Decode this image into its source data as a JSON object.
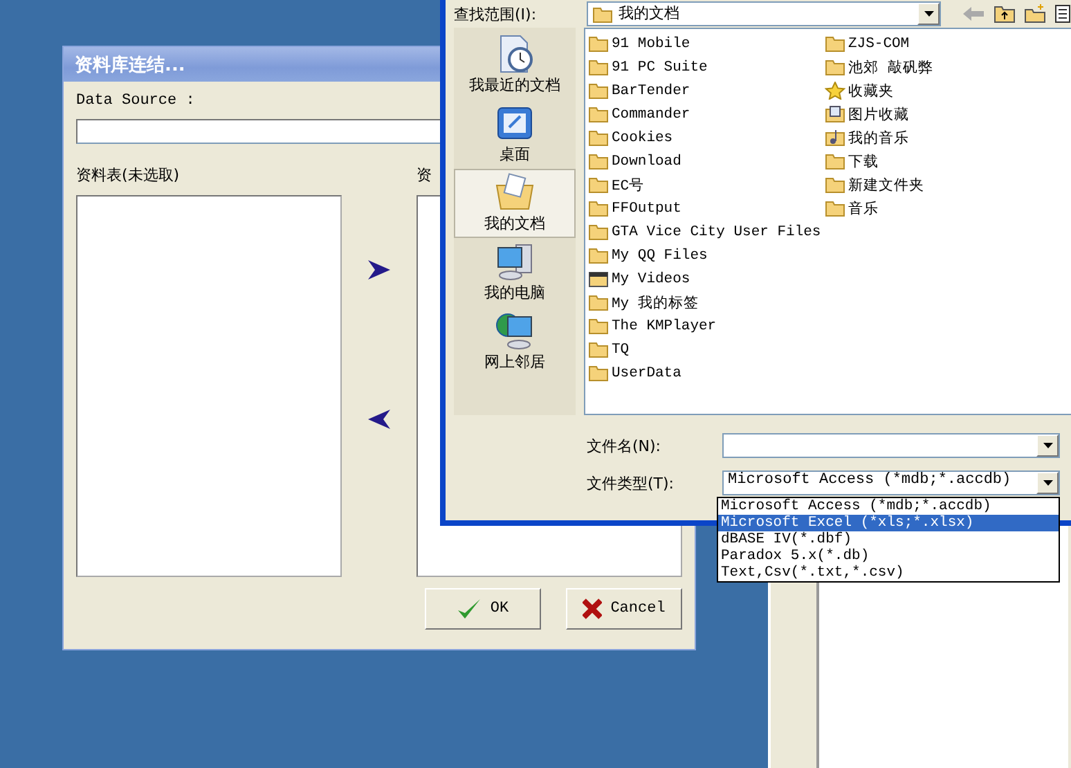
{
  "data_dialog": {
    "title": "资料库连结...",
    "data_source_label": "Data Source :",
    "tables_label": "资料表(未选取)",
    "second_label": "资",
    "buttons": [
      {
        "label": "OK",
        "kind": "ok"
      },
      {
        "label": "Cancel",
        "kind": "cancel"
      }
    ]
  },
  "file_dialog": {
    "look_in_label": "查找范围(I):",
    "look_in_value": "我的文档",
    "places": [
      {
        "label": "我最近的文档",
        "kind": "recent",
        "selected": false
      },
      {
        "label": "桌面",
        "kind": "desktop",
        "selected": false
      },
      {
        "label": "我的文档",
        "kind": "documents",
        "selected": true
      },
      {
        "label": "我的电脑",
        "kind": "computer",
        "selected": false
      },
      {
        "label": "网上邻居",
        "kind": "network",
        "selected": false
      }
    ],
    "files": [
      {
        "name": "91 Mobile",
        "kind": "folder"
      },
      {
        "name": "91 PC Suite",
        "kind": "folder"
      },
      {
        "name": "BarTender",
        "kind": "folder"
      },
      {
        "name": "Commander",
        "kind": "folder"
      },
      {
        "name": "Cookies",
        "kind": "folder"
      },
      {
        "name": "Download",
        "kind": "folder"
      },
      {
        "name": "EC号",
        "kind": "folder"
      },
      {
        "name": "FFOutput",
        "kind": "folder"
      },
      {
        "name": "GTA Vice City User Files",
        "kind": "folder"
      },
      {
        "name": "My QQ Files",
        "kind": "folder"
      },
      {
        "name": "My Videos",
        "kind": "videos"
      },
      {
        "name": "My 我的标签",
        "kind": "folder"
      },
      {
        "name": "The KMPlayer",
        "kind": "folder"
      },
      {
        "name": "TQ",
        "kind": "folder"
      },
      {
        "name": "UserData",
        "kind": "folder"
      },
      {
        "name": "ZJS-COM",
        "kind": "folder"
      },
      {
        "name": "池郊 敲矾弊",
        "kind": "folder"
      },
      {
        "name": "收藏夹",
        "kind": "favorites"
      },
      {
        "name": "图片收藏",
        "kind": "pictures"
      },
      {
        "name": "我的音乐",
        "kind": "music"
      },
      {
        "name": "下载",
        "kind": "folder"
      },
      {
        "name": "新建文件夹",
        "kind": "folder"
      },
      {
        "name": "音乐",
        "kind": "folder"
      }
    ],
    "file_name_label": "文件名(N):",
    "file_type_label": "文件类型(T):",
    "file_type_value": "Microsoft Access (*mdb;*.accdb)",
    "file_type_options": [
      {
        "label": "Microsoft Access (*mdb;*.accdb)",
        "selected": false
      },
      {
        "label": "Microsoft Excel (*xls;*.xlsx)",
        "selected": true
      },
      {
        "label": "dBASE IV(*.dbf)",
        "selected": false
      },
      {
        "label": "Paradox 5.x(*.db)",
        "selected": false
      },
      {
        "label": "Text,Csv(*.txt,*.csv)",
        "selected": false
      }
    ]
  }
}
